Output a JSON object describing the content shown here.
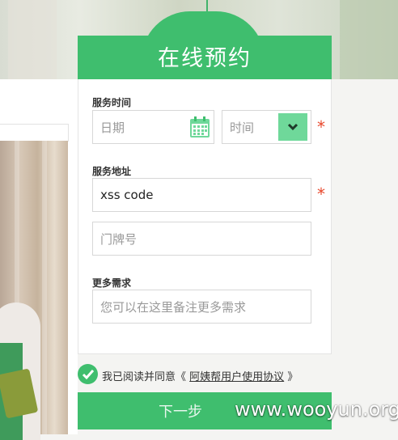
{
  "header": {
    "title": "在线预约"
  },
  "form": {
    "service_time_label": "服务时间",
    "date_placeholder": "日期",
    "time_placeholder": "时间",
    "service_address_label": "服务地址",
    "address_value": "xss code",
    "house_number_placeholder": "门牌号",
    "more_needs_label": "更多需求",
    "more_needs_placeholder": "您可以在这里备注更多需求",
    "required_mark": "*"
  },
  "agreement": {
    "prefix": "我已阅读并同意《",
    "link": "阿姨帮用户使用协议",
    "suffix": "》"
  },
  "next_button": {
    "label": "下一步"
  },
  "watermark": {
    "text": "www.wooyun.org"
  },
  "colors": {
    "brand_green": "#3fbe6e",
    "required_red": "#e8472b"
  },
  "icons": {
    "calendar": "calendar-icon",
    "dropdown": "chevron-down-icon",
    "check": "check-icon"
  }
}
